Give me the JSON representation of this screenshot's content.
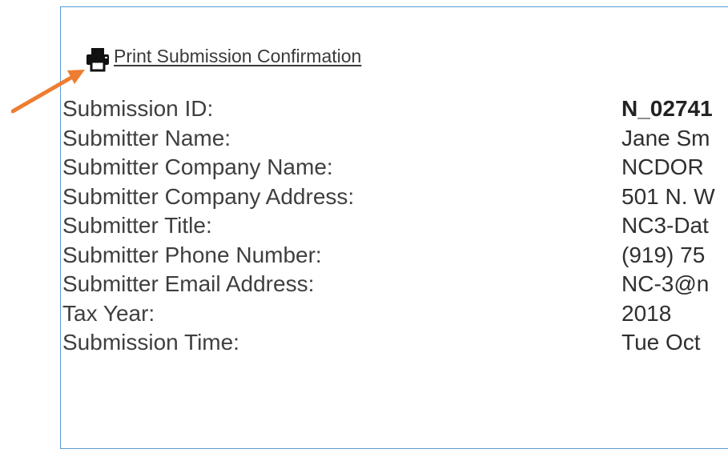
{
  "print_link": {
    "icon": "printer-icon",
    "label": "Print Submission Confirmation"
  },
  "details": [
    {
      "label": "Submission ID:",
      "value": "N_02741"
    },
    {
      "label": "Submitter Name:",
      "value": "Jane Sm"
    },
    {
      "label": "Submitter Company Name:",
      "value": "NCDOR"
    },
    {
      "label": "Submitter Company Address:",
      "value": "501 N. W"
    },
    {
      "label": "Submitter Title:",
      "value": "NC3-Dat"
    },
    {
      "label": "Submitter Phone Number:",
      "value": "(919) 75"
    },
    {
      "label": "Submitter Email Address:",
      "value": "NC-3@n"
    },
    {
      "label": "Tax Year:",
      "value": "2018"
    },
    {
      "label": "Submission Time:",
      "value": "Tue Oct"
    }
  ],
  "colors": {
    "panel_border": "#5b9bd5",
    "arrow": "#ed7d31",
    "text": "#3f3f3f"
  }
}
